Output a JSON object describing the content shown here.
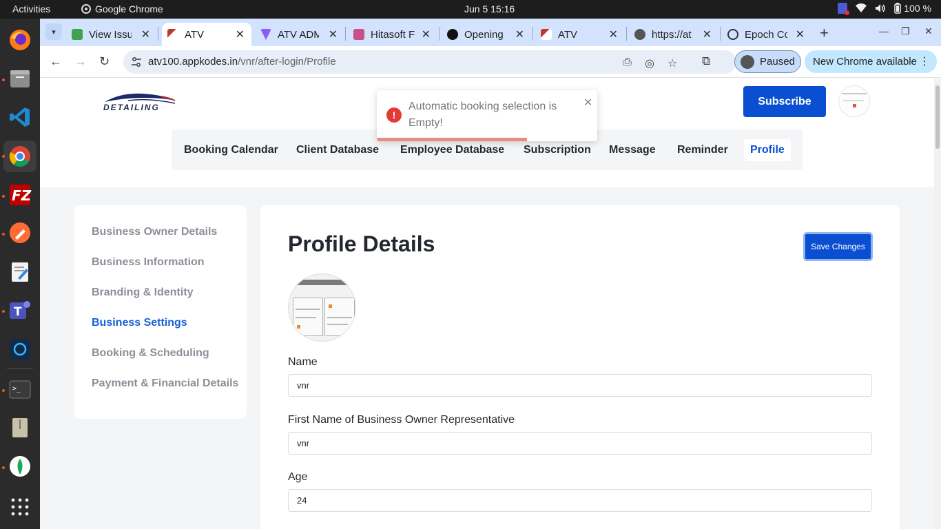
{
  "system": {
    "activities": "Activities",
    "app_name": "Google Chrome",
    "clock": "Jun 5  15:16",
    "battery": "100 %"
  },
  "tabs": [
    {
      "label": "View Issu",
      "active": false
    },
    {
      "label": "ATV",
      "active": true
    },
    {
      "label": "ATV ADM",
      "active": false
    },
    {
      "label": "Hitasoft F",
      "active": false
    },
    {
      "label": "Opening",
      "active": false
    },
    {
      "label": "ATV",
      "active": false
    },
    {
      "label": "https://at",
      "active": false
    },
    {
      "label": "Epoch Co",
      "active": false
    }
  ],
  "address_bar": {
    "host": "atv100.appkodes.in",
    "path": "/vnr/after-login/Profile"
  },
  "profile_chip": {
    "label": "Paused"
  },
  "update_chip": {
    "label": "New Chrome available"
  },
  "site": {
    "logo_text": "DETAILING",
    "subscribe_label": "Subscribe",
    "nav": [
      {
        "label": "Booking Calendar",
        "active": false
      },
      {
        "label": "Client Database",
        "active": false
      },
      {
        "label": "Employee Database",
        "active": false
      },
      {
        "label": "Subscription",
        "active": false
      },
      {
        "label": "Message",
        "active": false
      },
      {
        "label": "Reminder",
        "active": false
      },
      {
        "label": "Profile",
        "active": true
      }
    ]
  },
  "toast": {
    "message": "Automatic booking selection is Empty!",
    "progress_fraction": 0.68
  },
  "settings_nav": [
    {
      "label": "Business Owner Details",
      "active": false
    },
    {
      "label": "Business Information",
      "active": false
    },
    {
      "label": "Branding & Identity",
      "active": false
    },
    {
      "label": "Business Settings",
      "active": true
    },
    {
      "label": "Booking & Scheduling",
      "active": false
    },
    {
      "label": "Payment & Financial Details",
      "active": false
    }
  ],
  "profile": {
    "title": "Profile Details",
    "save_label": "Save Changes",
    "fields": [
      {
        "label": "Name",
        "value": "vnr"
      },
      {
        "label": "First Name of Business Owner Representative",
        "value": "vnr"
      },
      {
        "label": "Age",
        "value": "24"
      }
    ]
  },
  "colors": {
    "primary": "#0a4fd1",
    "active_link": "#1560d8",
    "error": "#e53935",
    "tabstrip": "#d3e3fd"
  }
}
